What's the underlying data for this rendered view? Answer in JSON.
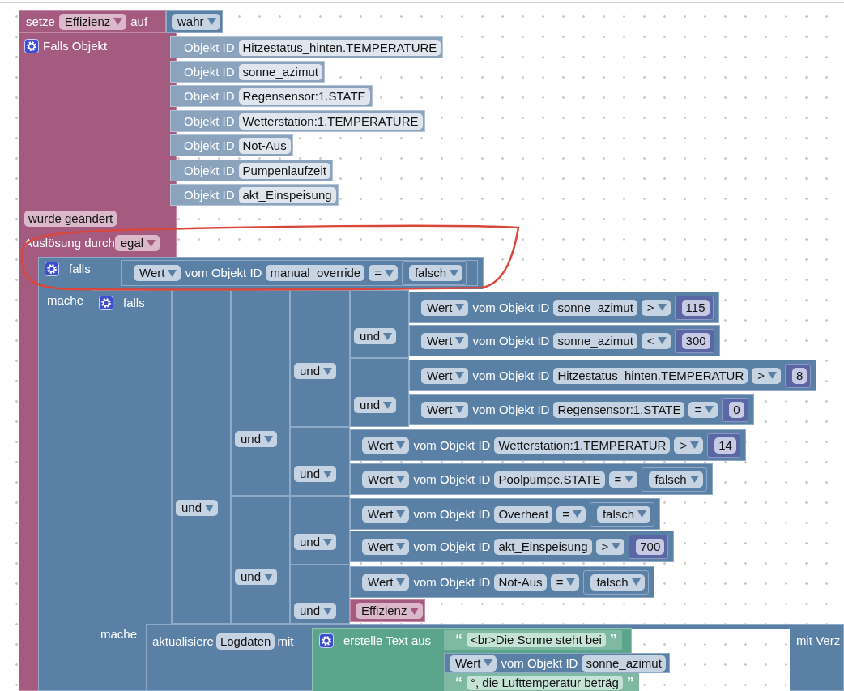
{
  "set_block": {
    "label": "setze",
    "variable": "Effizienz",
    "connector": "auf",
    "value": "wahr"
  },
  "trigger_block": {
    "label": "Falls Objekt",
    "object_ids": [
      {
        "label": "Objekt ID",
        "id": "Hitzestatus_hinten.TEMPERATURE"
      },
      {
        "label": "Objekt ID",
        "id": "sonne_azimut"
      },
      {
        "label": "Objekt ID",
        "id": "Regensensor:1.STATE"
      },
      {
        "label": "Objekt ID",
        "id": "Wetterstation:1.TEMPERATURE"
      },
      {
        "label": "Objekt ID",
        "id": "Not-Aus"
      },
      {
        "label": "Objekt ID",
        "id": "Pumpenlaufzeit"
      },
      {
        "label": "Objekt ID",
        "id": "akt_Einspeisung"
      }
    ],
    "event": "wurde geändert",
    "trigger_label": "Auslösung durch",
    "trigger_value": "egal"
  },
  "if_block": {
    "label": "falls",
    "do_label": "mache",
    "condition": {
      "value_label": "Wert",
      "of_label": "vom Objekt ID",
      "object": "manual_override",
      "operator": "=",
      "kind": "bool",
      "operand": "falsch"
    }
  },
  "inner_if": {
    "label": "falls",
    "do_label": "mache"
  },
  "and_operators": [
    "und",
    "und",
    "und",
    "und",
    "und",
    "und",
    "und",
    "und",
    "und"
  ],
  "comparisons": [
    {
      "value_label": "Wert",
      "of_label": "vom Objekt ID",
      "object": "sonne_azimut",
      "operator": ">",
      "kind": "number",
      "operand": "115"
    },
    {
      "value_label": "Wert",
      "of_label": "vom Objekt ID",
      "object": "sonne_azimut",
      "operator": "<",
      "kind": "number",
      "operand": "300"
    },
    {
      "value_label": "Wert",
      "of_label": "vom Objekt ID",
      "object": "Hitzestatus_hinten.TEMPERATUR",
      "operator": ">",
      "kind": "number",
      "operand": "8"
    },
    {
      "value_label": "Wert",
      "of_label": "vom Objekt ID",
      "object": "Regensensor:1.STATE",
      "operator": "=",
      "kind": "number",
      "operand": "0"
    },
    {
      "value_label": "Wert",
      "of_label": "vom Objekt ID",
      "object": "Wetterstation:1.TEMPERATUR",
      "operator": ">",
      "kind": "number",
      "operand": "14"
    },
    {
      "value_label": "Wert",
      "of_label": "vom Objekt ID",
      "object": "Poolpumpe.STATE",
      "operator": "=",
      "kind": "bool",
      "operand": "falsch"
    },
    {
      "value_label": "Wert",
      "of_label": "vom Objekt ID",
      "object": "Overheat",
      "operator": "=",
      "kind": "bool",
      "operand": "falsch"
    },
    {
      "value_label": "Wert",
      "of_label": "vom Objekt ID",
      "object": "akt_Einspeisung",
      "operator": ">",
      "kind": "number",
      "operand": "700"
    },
    {
      "value_label": "Wert",
      "of_label": "vom Objekt ID",
      "object": "Not-Aus",
      "operator": "=",
      "kind": "bool",
      "operand": "falsch"
    }
  ],
  "and_variable": "Effizienz",
  "update_block": {
    "label": "aktualisiere",
    "variable": "Logdaten",
    "connector": "mit",
    "suffix": "mit Verz",
    "text_block": {
      "label": "erstelle Text aus",
      "parts": [
        {
          "kind": "text",
          "open_quote": "“",
          "text": "<br>Die Sonne steht bei",
          "close_quote": "”"
        },
        {
          "kind": "value",
          "value_label": "Wert",
          "of_label": "vom Objekt ID",
          "object": "sonne_azimut"
        },
        {
          "kind": "text",
          "open_quote": "“",
          "text": "°, die Lufttemperatur beträg",
          "close_quote": "”"
        }
      ]
    }
  }
}
